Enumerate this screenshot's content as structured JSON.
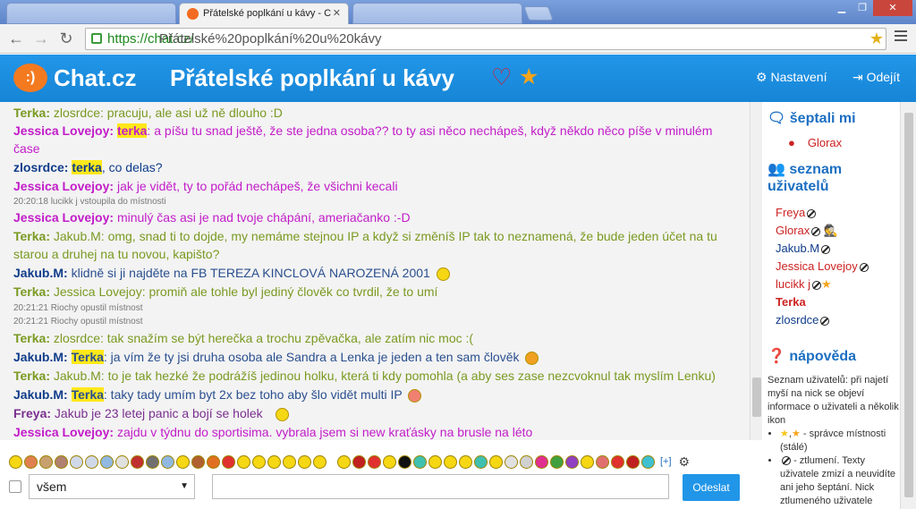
{
  "browser": {
    "active_tab_title": "Přátelské poplkání u kávy - C",
    "url_secure": "https://chat.cz/",
    "url_path": "Přátelské%20poplkání%20u%20kávy"
  },
  "header": {
    "logo_icon": ":)",
    "logo_text": "Chat.cz",
    "room_title": "Přátelské poplkání u kávy",
    "settings_label": "Nastavení",
    "leave_label": "Odejít"
  },
  "messages": [
    {
      "nick": "Terka:",
      "text": "zlosrdce: pracuju, ale asi už ně dlouho :D"
    },
    {
      "nick": "Jessica Lovejoy:",
      "hl": "terka",
      "text": ": a píšu tu snad ještě, že ste jedna osoba?? to ty asi něco nechápeš, když někdo něco píše v minulém čase"
    },
    {
      "nick": "zlosrdce:",
      "hl": "terka",
      "text": ", co delas?"
    },
    {
      "nick": "Jessica Lovejoy:",
      "text": "jak je vidět, ty to pořád nechápeš, že všichni kecali"
    },
    {
      "nick": "Jessica Lovejoy:",
      "text": "minulý čas asi je nad tvoje chápání, ameriačanko :-D"
    },
    {
      "nick": "Terka:",
      "text": "Jakub.M: omg, snad ti to dojde, my nemáme stejnou IP a když si změníš IP tak to neznamená, že bude jeden účet na tu starou a druhej na tu novou, kapišto?"
    },
    {
      "nick": "Jakub.M:",
      "text": "klidně si ji najděte na FB TEREZA KINCLOVÁ NAROZENÁ 2001"
    },
    {
      "nick": "Terka:",
      "text": "Jessica Lovejoy: promiň ale tohle byl jediný člověk co tvrdil, že to umí"
    },
    {
      "nick": "Terka:",
      "text": "zlosrdce: tak snažím se být herečka a trochu zpěvačka, ale zatím nic moc :("
    },
    {
      "nick": "Jakub.M:",
      "hl": "Terka",
      "text": ": ja vím že ty jsi druha osoba ale Sandra a Lenka je jeden a ten sam člověk"
    },
    {
      "nick": "Terka:",
      "text": "Jakub.M: to je tak hezké že podrážíš jedinou holku, která ti kdy pomohla (a aby ses zase nezcvoknul tak myslím Lenku)"
    },
    {
      "nick": "Jakub.M:",
      "hl": "Terka",
      "text": ": taky tady umím byt 2x bez toho aby šlo vidět multi IP"
    },
    {
      "nick": "Freya:",
      "text": "Jakub je 23 letej panic a bojí se holek"
    },
    {
      "nick": "Jessica Lovejoy:",
      "text": "zajdu v týdnu do sportisima. vybrala jsem si new kraťásky na brusle na léto"
    }
  ],
  "system": [
    "20:20:18 lucikk j vstoupila do místnosti",
    "20:21:21 Riochy opustil místnost",
    "20:21:21 Riochy opustil místnost"
  ],
  "sidebar": {
    "whispered_title": "šeptali mi",
    "whispered": [
      "Glorax"
    ],
    "users_title_1": "seznam",
    "users_title_2": "uživatelů",
    "users": [
      "Freya",
      "Glorax",
      "Jakub.M",
      "Jessica Lovejoy",
      "lucikk j",
      "Terka",
      "zlosrdce"
    ],
    "help_title": "nápověda",
    "help_intro": "Seznam uživatelů: při najetí myší na nick se objeví informace o uživateli a několik ikon",
    "help_admin": "- správce místnosti (stálé)",
    "help_mute": "- ztlumení. Texty uživatele zmizí a neuvidíte ani jeho šeptání. Nick ztlumeného uživatele"
  },
  "composer": {
    "emoji_more": "[+]",
    "recipient": "všem",
    "send_label": "Odeslat"
  },
  "colors": {
    "accent": "#2196e8",
    "logo": "#f47a20",
    "highlight": "#ffe81a"
  }
}
